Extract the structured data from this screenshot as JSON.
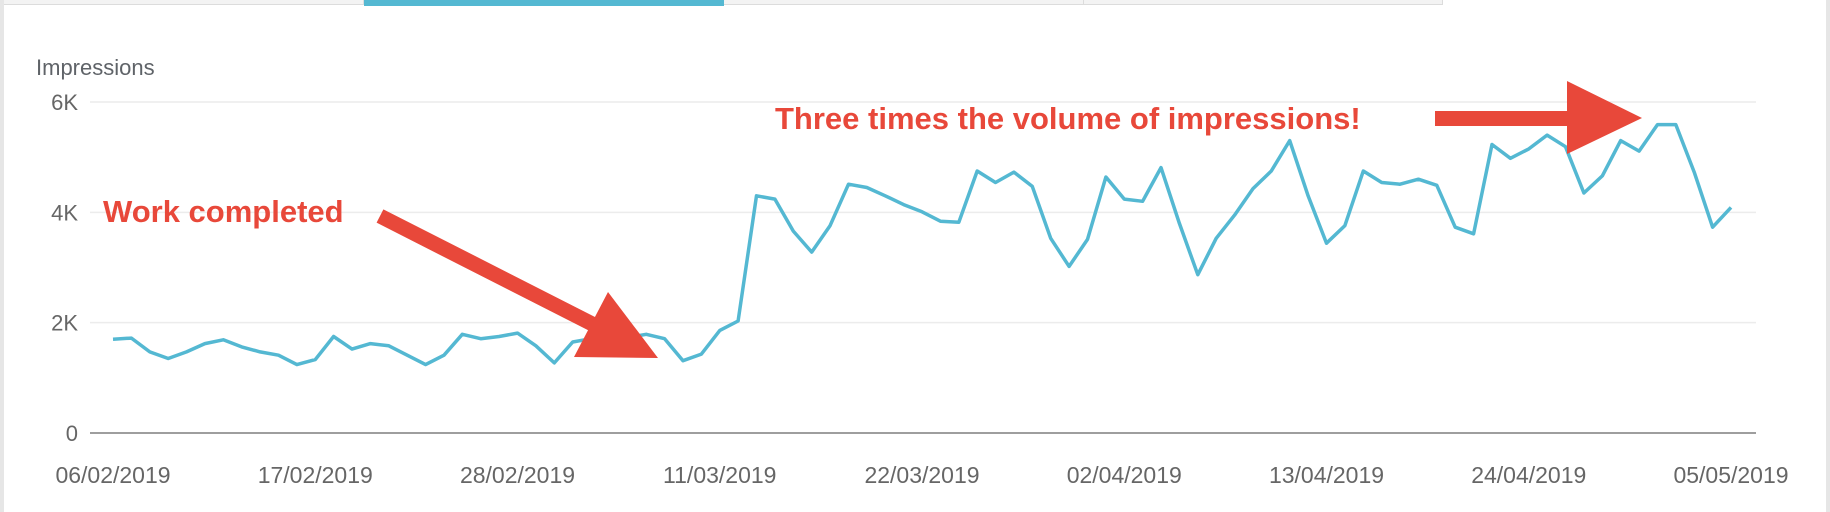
{
  "tabs": [
    {
      "label": "",
      "active": false
    },
    {
      "label": "",
      "active": true
    },
    {
      "label": "",
      "active": false
    },
    {
      "label": "",
      "active": false
    }
  ],
  "colors": {
    "line": "#54b8d2",
    "annotation": "#e8483a",
    "grid": "#ececec",
    "axis": "#9e9e9e",
    "active_tab": "#54b8d2"
  },
  "chart_data": {
    "type": "line",
    "title": "",
    "ylabel": "Impressions",
    "xlabel": "",
    "ylim": [
      0,
      6000
    ],
    "yticks": [
      0,
      2000,
      4000,
      6000
    ],
    "ytick_labels": [
      "0",
      "2K",
      "4K",
      "6K"
    ],
    "xtick_labels": [
      "06/02/2019",
      "17/02/2019",
      "28/02/2019",
      "11/03/2019",
      "22/03/2019",
      "02/04/2019",
      "13/04/2019",
      "24/04/2019",
      "05/05/2019"
    ],
    "x_start": "06/02/2019",
    "x_end": "05/05/2019",
    "grid": true,
    "series": [
      {
        "name": "Impressions",
        "values": [
          1700,
          1720,
          1470,
          1350,
          1470,
          1620,
          1690,
          1560,
          1470,
          1410,
          1240,
          1330,
          1750,
          1520,
          1620,
          1580,
          1410,
          1240,
          1410,
          1790,
          1710,
          1750,
          1810,
          1580,
          1270,
          1650,
          1710,
          1670,
          1730,
          1790,
          1710,
          1310,
          1430,
          1860,
          2030,
          4300,
          4240,
          3660,
          3280,
          3760,
          4510,
          4450,
          4300,
          4140,
          4010,
          3840,
          3820,
          4750,
          4540,
          4730,
          4470,
          3530,
          3020,
          3510,
          4640,
          4240,
          4200,
          4810,
          3800,
          2870,
          3530,
          3950,
          4430,
          4750,
          5300,
          4300,
          3440,
          3760,
          4750,
          4540,
          4510,
          4600,
          4490,
          3730,
          3610,
          5230,
          4980,
          5150,
          5400,
          5190,
          4350,
          4660,
          5300,
          5110,
          5590,
          5590,
          4730,
          3730,
          4090
        ]
      }
    ],
    "annotations": [
      {
        "text": "Work completed",
        "arrow_direction": "down-right",
        "points_to": "11/03/2019"
      },
      {
        "text": "Three times the volume of impressions!",
        "arrow_direction": "right",
        "points_to": "05/05/2019"
      }
    ]
  }
}
